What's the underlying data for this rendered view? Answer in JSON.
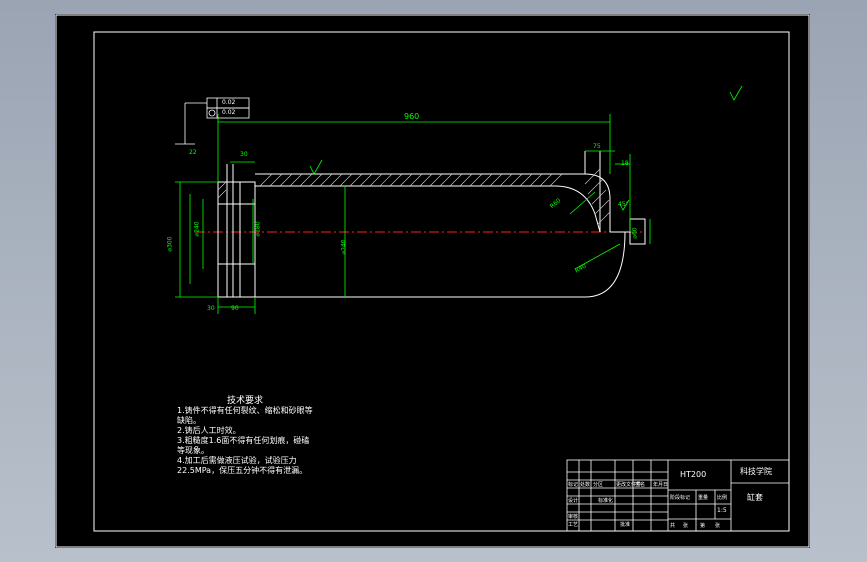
{
  "drawing": {
    "colors": {
      "background": "#000000",
      "frame": "#ffffff",
      "dimension": "#00ff00",
      "centerline": "#ff2020",
      "part": "#ffffff",
      "viewport_bg": "#a7b0bd"
    },
    "dimensions": {
      "overall_length": "960",
      "flange_width": "30",
      "small_step": "22",
      "inner_dia_240": "⌀240",
      "inner_dia_180": "⌀180",
      "outer_dia_300": "⌀300",
      "outer_dia_240": "⌀240",
      "end_dia_60": "⌀60",
      "radius_60": "R60",
      "radius_40": "R40",
      "top_75": "75",
      "top_18": "18",
      "bottom_90": "90",
      "bottom_small": "30",
      "wall_30": "30",
      "angle_mark": "45°"
    },
    "tolerance_frame": [
      "0.02",
      "0.02"
    ]
  },
  "technical_requirements": {
    "title": "技术要求",
    "lines": [
      "1.铸件不得有任何裂纹、缩松和砂眼等",
      "缺陷。",
      "2.铸后人工时效。",
      "3.粗糙度1.6面不得有任何划痕，碰磕",
      "等现象。",
      "4.加工后需做液压试验，试验压力",
      "22.5MPa，保压五分钟不得有泄漏。"
    ]
  },
  "title_block": {
    "material": "HT200",
    "school": "科技学院",
    "part_name": "缸套",
    "labels": [
      "标记",
      "处数",
      "分区",
      "更改文件号",
      "签名",
      "年月日"
    ],
    "row2": [
      "设计",
      "标准化",
      "阶段标记",
      "重量",
      "比例"
    ],
    "row3": [
      "审核",
      "工艺",
      "批准"
    ],
    "sheet": [
      "共",
      "张",
      "第",
      "张"
    ],
    "scale": "1:5"
  }
}
